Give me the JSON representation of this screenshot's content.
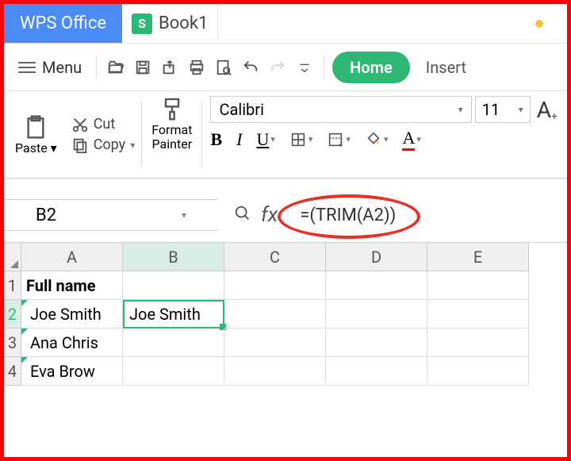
{
  "title_bar": {
    "app_name": "WPS Office",
    "tab_icon_letter": "S",
    "tab_title": "Book1"
  },
  "menu_label": "Menu",
  "ribbon_tabs": {
    "home": "Home",
    "insert": "Insert"
  },
  "clipboard": {
    "paste": "Paste",
    "cut": "Cut",
    "copy": "Copy",
    "format_painter_line1": "Format",
    "format_painter_line2": "Painter"
  },
  "font": {
    "name": "Calibri",
    "size": "11"
  },
  "formula_bar": {
    "name_box": "B2",
    "fx": "fx",
    "formula": "=(TRIM(A2))"
  },
  "grid": {
    "columns": [
      "A",
      "B",
      "C",
      "D",
      "E"
    ],
    "rows": [
      "1",
      "2",
      "3",
      "4"
    ],
    "cells": {
      "A1": "Full name",
      "A2": " Joe Smith",
      "A3": " Ana Chris",
      "A4": " Eva Brow",
      "B2": "Joe Smith"
    }
  }
}
